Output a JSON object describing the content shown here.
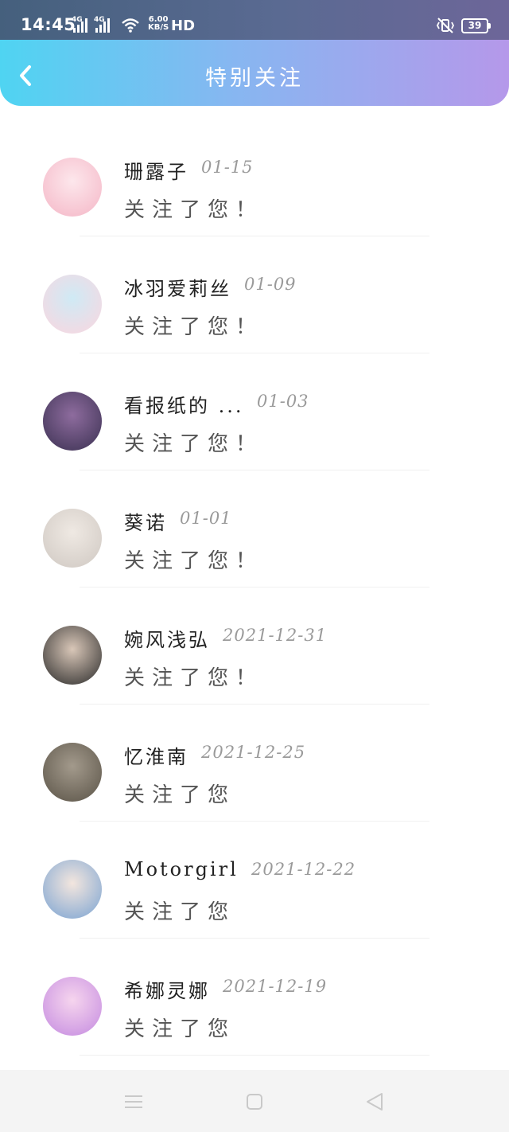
{
  "status_bar": {
    "time": "14:45",
    "network_1": "4G",
    "network_2": "4G",
    "speed_value": "6.00",
    "speed_unit": "KB/S",
    "hd": "HD",
    "battery": "39"
  },
  "header": {
    "title": "特别关注",
    "back_icon": "chevron-left-icon"
  },
  "items": [
    {
      "name": "珊露子",
      "date": "01-15",
      "message": "关注了您！",
      "avatar_colors": [
        "#f4b6c6",
        "#fde7ec"
      ]
    },
    {
      "name": "冰羽爱莉丝",
      "date": "01-09",
      "message": "关注了您！",
      "avatar_colors": [
        "#fbd6df",
        "#cfeaf5"
      ]
    },
    {
      "name": "看报纸的 ...",
      "date": "01-03",
      "message": "关注了您！",
      "avatar_colors": [
        "#3b3152",
        "#8e6c9e"
      ]
    },
    {
      "name": "葵诺",
      "date": "01-01",
      "message": "关注了您！",
      "avatar_colors": [
        "#cfc8c2",
        "#efe9e3"
      ]
    },
    {
      "name": "婉风浅弘",
      "date": "2021-12-31",
      "message": "关注了您！",
      "avatar_colors": [
        "#2a2a2a",
        "#d9c7b8"
      ]
    },
    {
      "name": "忆淮南",
      "date": "2021-12-25",
      "message": "关注了您",
      "avatar_colors": [
        "#5a5347",
        "#a39a8c"
      ]
    },
    {
      "name": "Motorgirl",
      "date": "2021-12-22",
      "message": "关注了您",
      "avatar_colors": [
        "#7aa3d2",
        "#f3e6de"
      ]
    },
    {
      "name": "希娜灵娜",
      "date": "2021-12-19",
      "message": "关注了您",
      "avatar_colors": [
        "#c48ae0",
        "#f6d5ee"
      ]
    }
  ],
  "nav_bar": {
    "menu_icon": "menu-icon",
    "home_icon": "home-square-icon",
    "back_icon": "back-triangle-icon"
  }
}
